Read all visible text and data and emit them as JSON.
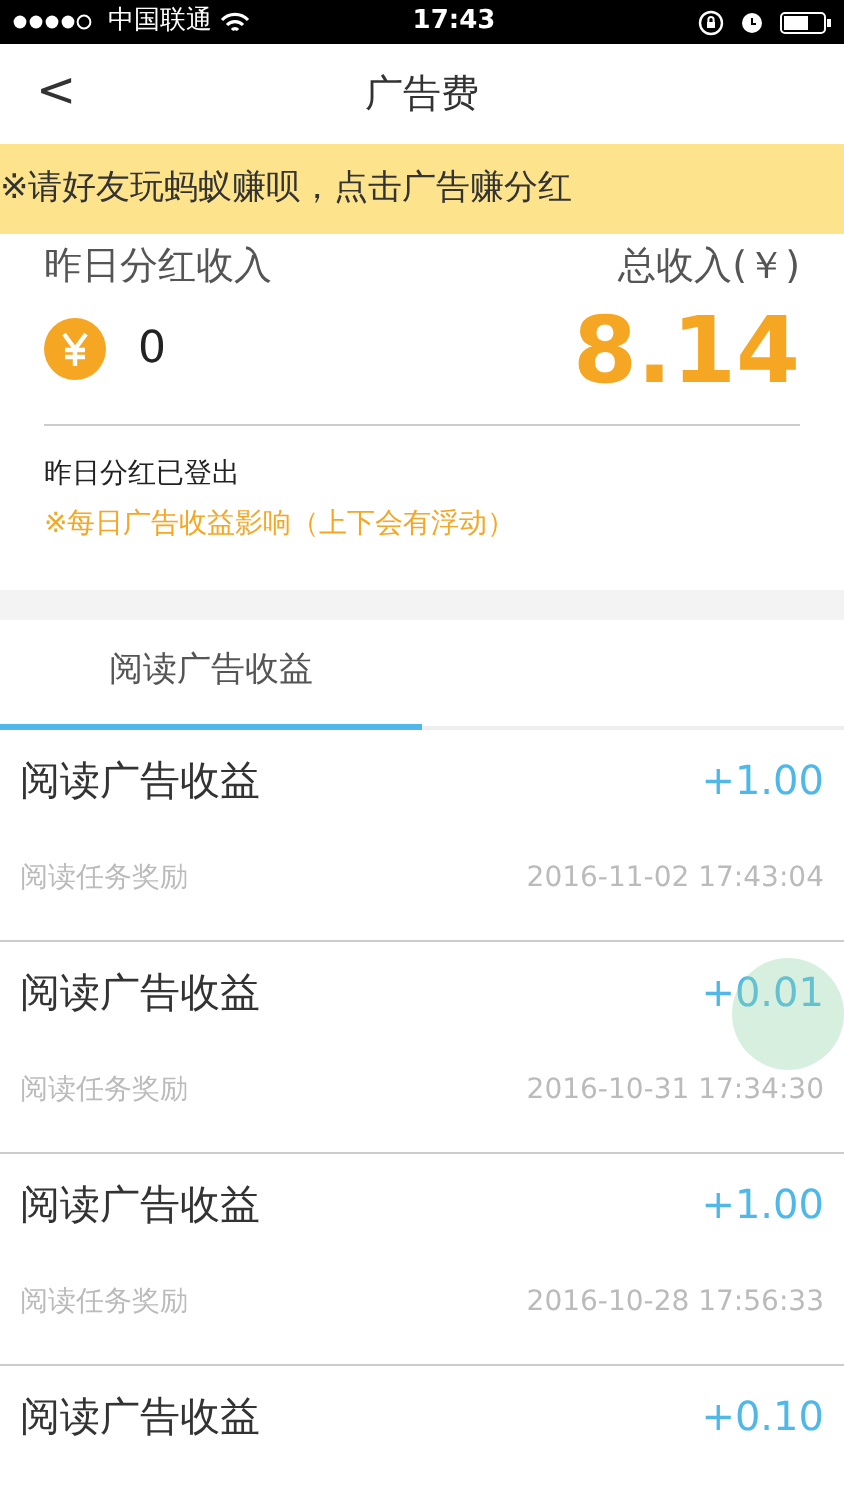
{
  "status_bar": {
    "carrier": "中国联通",
    "time": "17:43"
  },
  "nav": {
    "back": "<",
    "title": "广告费"
  },
  "notice": "※请好友玩蚂蚁赚呗，点击广告赚分红",
  "summary": {
    "yesterday_label": "昨日分红收入",
    "yesterday_value": "0",
    "total_label": "总收入(￥)",
    "total_value": "8.14",
    "status": "昨日分红已登出",
    "note": "※每日广告收益影响（上下会有浮动）"
  },
  "tabs": [
    {
      "label": "阅读广告收益",
      "selected": true
    }
  ],
  "records": [
    {
      "title": "阅读广告收益",
      "amount": "+1.00",
      "source": "阅读任务奖励",
      "time": "2016-11-02 17:43:04",
      "touched": false
    },
    {
      "title": "阅读广告收益",
      "amount": "+0.01",
      "source": "阅读任务奖励",
      "time": "2016-10-31 17:34:30",
      "touched": true
    },
    {
      "title": "阅读广告收益",
      "amount": "+1.00",
      "source": "阅读任务奖励",
      "time": "2016-10-28 17:56:33",
      "touched": false
    },
    {
      "title": "阅读广告收益",
      "amount": "+0.10",
      "touched": false
    }
  ]
}
